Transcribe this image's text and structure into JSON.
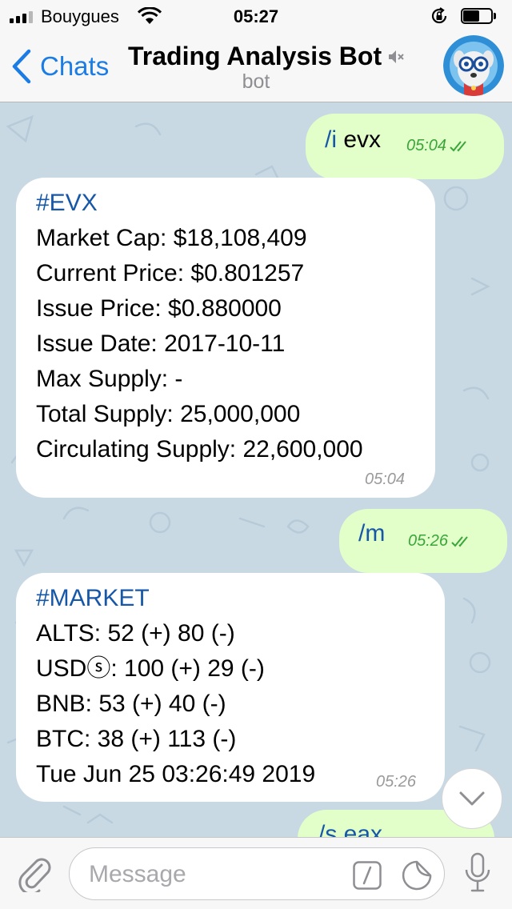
{
  "status_bar": {
    "carrier": "Bouygues",
    "time": "05:27",
    "signal_bars_filled": 3,
    "signal_bars_total": 4,
    "battery_level_percent": 50
  },
  "header": {
    "back_label": "Chats",
    "title": "Trading Analysis Bot",
    "subtitle": "bot",
    "muted_icon": "speaker-muted-icon",
    "accent_color": "#1a7ce4"
  },
  "messages": {
    "m1": {
      "direction": "outgoing",
      "command": "/i",
      "arg": " evx",
      "time": "05:04",
      "status": "read"
    },
    "m2": {
      "direction": "incoming",
      "hashtag": "#EVX",
      "lines": [
        "Market Cap: $18,108,409",
        "Current Price: $0.801257",
        "Issue Price: $0.880000",
        "Issue Date: 2017-10-11",
        "Max Supply: -",
        "Total Supply: 25,000,000",
        "Circulating Supply: 22,600,000"
      ],
      "time": "05:04"
    },
    "m3": {
      "direction": "outgoing",
      "command": "/m",
      "time": "05:26",
      "status": "read"
    },
    "m4": {
      "direction": "incoming",
      "hashtag": "#MARKET",
      "lines": [
        "ALTS: 52 (+) 80 (-)",
        "USDⓢ: 100 (+) 29 (-)",
        "BNB: 53 (+) 40 (-)",
        "BTC: 38 (+) 113 (-)",
        "Tue Jun 25 03:26:49 2019"
      ],
      "time": "05:26"
    },
    "m5_partial": {
      "direction": "outgoing",
      "text": "/s eax"
    }
  },
  "colors": {
    "outgoing_bubble": "#e2fec9",
    "incoming_bubble": "#ffffff",
    "hashtag": "#1757a8",
    "read_check": "#3aa63a",
    "wallpaper": "#c9d9e4"
  },
  "input": {
    "placeholder": "Message",
    "value": ""
  },
  "icons": [
    "paperclip-icon",
    "bot-command-icon",
    "sticker-icon",
    "microphone-icon",
    "chevron-down-icon",
    "back-chevron-icon",
    "wifi-icon",
    "orientation-lock-icon",
    "battery-icon"
  ]
}
